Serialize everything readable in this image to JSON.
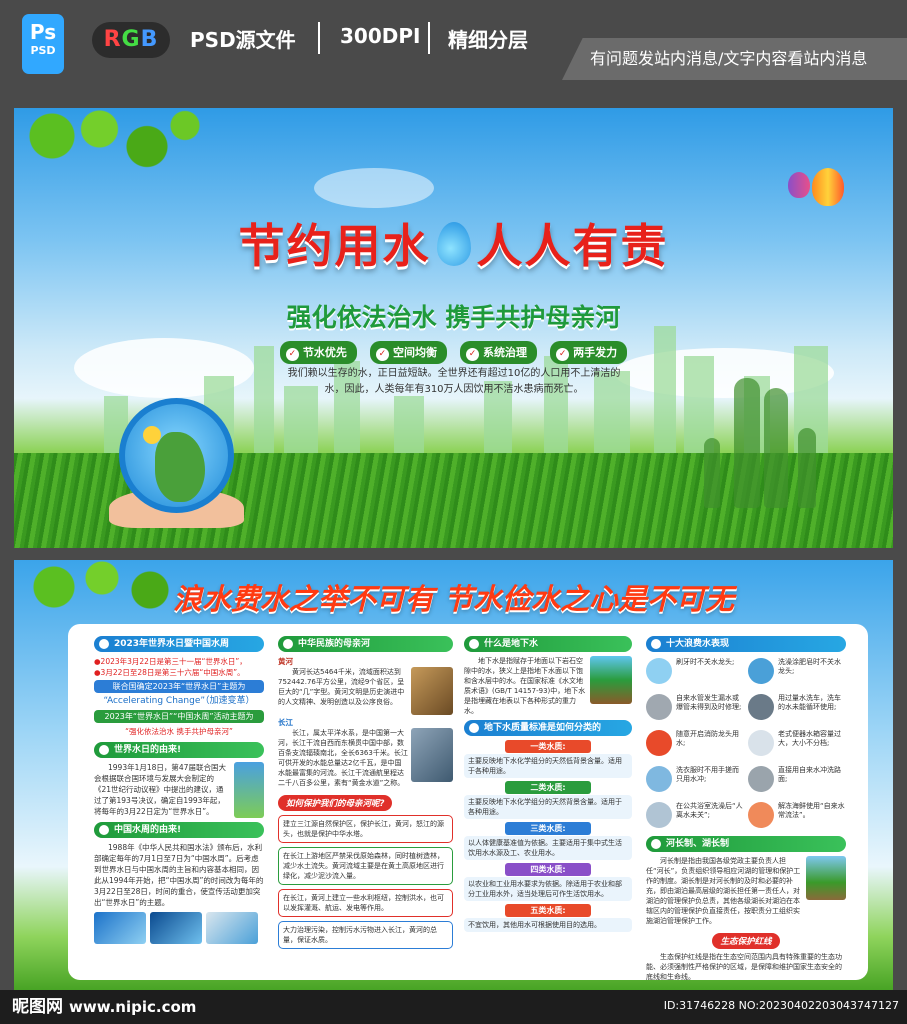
{
  "topbar": {
    "ps_big": "Ps",
    "ps_small": "PSD",
    "rgb_r": "R",
    "rgb_g": "G",
    "rgb_b": "B",
    "psd_label": "PSD源文件",
    "dpi_label": "300DPI",
    "layer_label": "精细分层",
    "notice": "有问题发站内消息/文字内容看站内消息"
  },
  "poster1": {
    "title_left": "节约用水",
    "title_right": "人人有责",
    "subtitle": "强化依法治水 携手共护母亲河",
    "badges": [
      "节水优先",
      "空间均衡",
      "系统治理",
      "两手发力"
    ],
    "intro_1": "我们赖以生存的水，正日益短缺。全世界还有超过10亿的人口用不上清洁的",
    "intro_2": "水，因此，人类每年有310万人因饮用不洁水患病而死亡。"
  },
  "poster2": {
    "slogan": "浪水费水之举不可有 节水俭水之心是不可无",
    "col1": {
      "h1": "2023年世界水日暨中国水周",
      "l1": "●2023年3月22日是第三十一届“世界水日”，",
      "l2": "●3月22日至28日是第三十六届“中国水周”。",
      "box1": "联合国确定2023年“世界水日”主题为",
      "accel": "“Accelerating Change”（加速变革）",
      "box2": "2023年“世界水日”“中国水周”活动主题为",
      "theme": "“强化依法治水 携手共护母亲河”",
      "h2": "世界水日的由来!",
      "p2": "1993年1月18日，第47届联合国大会根据联合国环境与发展大会制定的《21世纪行动议程》中提出的建议，通过了第193号决议，确定自1993年起，将每年的3月22日定为“世界水日”。",
      "h3": "中国水周的由来!",
      "p3": "1988年《中华人民共和国水法》颁布后，水利部确定每年的7月1日至7日为“中国水周”。后考虑到世界水日与中国水周的主旨和内容基本相同，因此从1994年开始，把“中国水周”的时间改为每年的3月22日至28日，时间的重合，使宣传活动更加突出“世界水日”的主题。"
    },
    "col2": {
      "h1": "中华民族的母亲河",
      "huanghe_tag": "黄河",
      "huanghe": "黄河长达5464千米，流域面积达到752442.76平方公里，流经9个省区，呈巨大的“几”字型。黄河文明是历史演进中的人文精神、发明创造以及公序良俗。",
      "changjiang_tag": "长江",
      "changjiang": "长江，属太平洋水系，是中国第一大河，长江干流自西而东横贯中国中部，数百条支流辐辏南北，全长6363千米。长江可供开发的水能总量达2亿千瓦，是中国水能最富集的河流。长江干流通航里程达二千八百多公里，素有“黄金水道”之称。",
      "q": "如何保护我们的母亲河呢?",
      "items": [
        "建立三江源自然保护区，保护长江，黄河，怒江的源头，也就是保护中华水塔。",
        "在长江上游地区严禁采伐原始森林，同时植树造林，减少水土流失。黄河流域主要是在黄土高原地区进行绿化，减少泥沙流入量。",
        "在长江，黄河上建立一些水利枢纽，控制洪水，也可以发挥灌溉、航运、发电等作用。",
        "大力治理污染，控制污水污物进入长江，黄河的总量，保证水质。"
      ]
    },
    "col3": {
      "h1": "什么是地下水",
      "p1": "地下水是指赋存于地面以下岩石空隙中的水，狭义上是指地下水面以下饱和含水层中的水。在国家标准《水文地质术语》(GB/T 14157-93)中，地下水是指埋藏在地表以下各种形式的重力水。",
      "h2": "地下水质量标准是如何分类的",
      "classes": [
        {
          "name": "一类水质:",
          "text": "主要反映地下水化学组分的天然低背景含量。适用于各种用途。"
        },
        {
          "name": "二类水质:",
          "text": "主要反映地下水化学组分的天然背景含量。适用于各种用途。"
        },
        {
          "name": "三类水质:",
          "text": "以人体健康基准值为依据。主要适用于集中式生活饮用水水源及工、农业用水。"
        },
        {
          "name": "四类水质:",
          "text": "以农业和工业用水要求为依据。除适用于农业和部分工业用水外，适当处理后可作生活饮用水。"
        },
        {
          "name": "五类水质:",
          "text": "不宜饮用，其他用水可根据使用目的选用。"
        }
      ]
    },
    "col4": {
      "h1": "十大浪费水表现",
      "waste": [
        "刷牙时不关水龙头;",
        "洗澡涂肥皂时不关水龙头;",
        "自来水管发生漏水或爆管未得到及时修理;",
        "用过量水洗车，洗车的水未能循环使用;",
        "随意开启消防龙头用水;",
        "老式便器水箱容量过大，大小不分档;",
        "洗衣服时不用手搓而只用水冲;",
        "直接用自来水冲洗路面;",
        "在公共浴室洗澡后“人离水未关”;",
        "解冻海鲜使用“自来水常流法”。"
      ],
      "h2": "河长制、湖长制",
      "p2": "河长制是指由我国各级党政主要负责人担任“河长”，负责组织领导相应河湖的管理和保护工作的制度。湖长制是对河长制的及时和必要的补充，即由湖泊最高层级的湖长担任第一责任人，对湖泊的管理保护负总责，其他各级湖长对湖泊在本辖区内的管理保护负直接责任，按职责分工组织实施湖泊管理保护工作。",
      "redline": "生态保护红线",
      "p3": "生态保护红线是指在生态空间范围内具有特殊重要的生态功能、必须强制性严格保护的区域，是保障和维护国家生态安全的底线和生命线。"
    }
  },
  "footer": {
    "site": "昵图网",
    "url": "www.nipic.com",
    "id": "ID:31746228 NO:20230402203043747127"
  }
}
